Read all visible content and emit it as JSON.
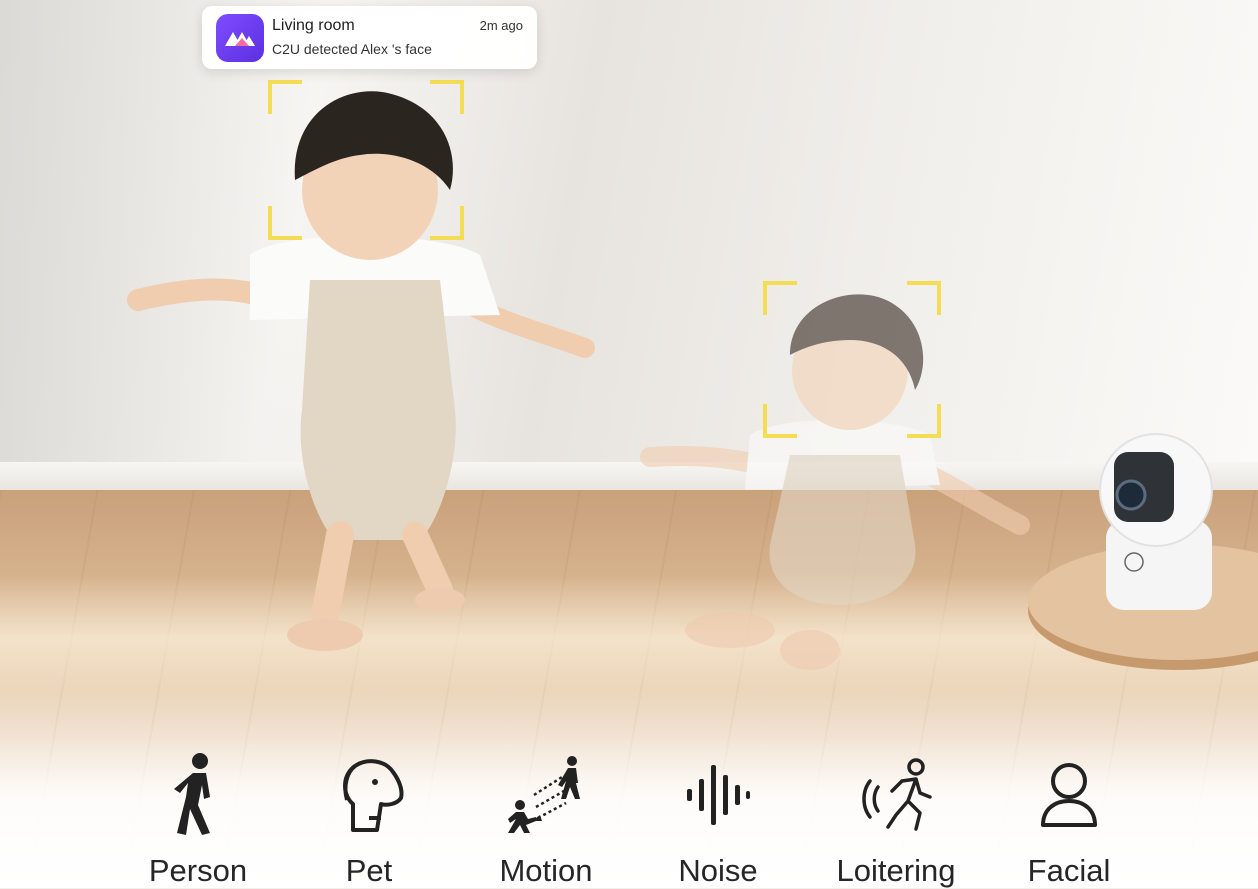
{
  "notification": {
    "app_icon": "camera-app-logo-icon",
    "title": "Living room",
    "body": "C2U detected Alex 's face",
    "time": "2m ago"
  },
  "scene": {
    "description_icon": "baby-monitoring-photo",
    "detection_frame_color": "#f4dc55"
  },
  "features": [
    {
      "label": "Person",
      "icon": "person-walking-icon"
    },
    {
      "label": "Pet",
      "icon": "dog-face-icon"
    },
    {
      "label": "Motion",
      "icon": "motion-figures-icon"
    },
    {
      "label": "Noise",
      "icon": "sound-wave-icon"
    },
    {
      "label": "Loitering",
      "icon": "loitering-person-icon"
    },
    {
      "label": "Facial",
      "icon": "face-user-icon"
    }
  ]
}
